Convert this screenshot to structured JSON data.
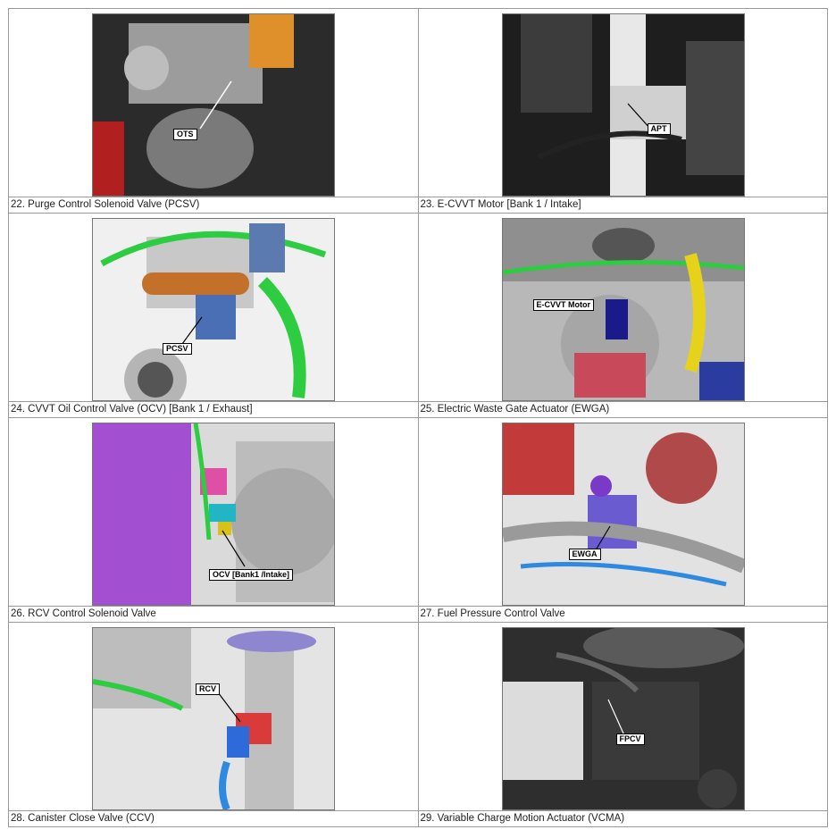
{
  "rows": [
    {
      "left": {
        "caption": "22. Purge Control Solenoid Valve (PCSV)",
        "label": "OTS"
      },
      "right": {
        "caption": "23. E-CVVT Motor [Bank 1 / Intake]",
        "label": "APT"
      }
    },
    {
      "left": {
        "caption": "24. CVVT Oil Control Valve (OCV) [Bank 1 / Exhaust]",
        "label": "PCSV"
      },
      "right": {
        "caption": "25. Electric Waste Gate Actuator (EWGA)",
        "label": "E-CVVT Motor"
      }
    },
    {
      "left": {
        "caption": "26. RCV Control Solenoid Valve",
        "label": "OCV [Bank1 /Intake]"
      },
      "right": {
        "caption": "27. Fuel Pressure Control Valve",
        "label": "EWGA"
      }
    },
    {
      "left": {
        "caption": "28. Canister Close Valve (CCV)",
        "label": "RCV"
      },
      "right": {
        "caption": "29. Variable Charge Motion Actuator (VCMA)",
        "label": "FPCV"
      }
    }
  ]
}
